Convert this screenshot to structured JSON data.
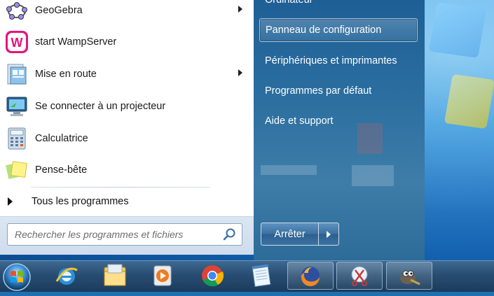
{
  "start_menu": {
    "programs": [
      {
        "label": "GeoGebra",
        "icon": "geogebra-icon",
        "has_submenu": true
      },
      {
        "label": "start WampServer",
        "icon": "wampserver-icon",
        "has_submenu": false
      },
      {
        "label": "Mise en route",
        "icon": "getting-started-icon",
        "has_submenu": true
      },
      {
        "label": "Se connecter à un projecteur",
        "icon": "projector-icon",
        "has_submenu": false
      },
      {
        "label": "Calculatrice",
        "icon": "calculator-icon",
        "has_submenu": false
      },
      {
        "label": "Pense-bête",
        "icon": "sticky-notes-icon",
        "has_submenu": false
      }
    ],
    "all_programs_label": "Tous les programmes",
    "search": {
      "placeholder": "Rechercher les programmes et fichiers"
    }
  },
  "right_pane": {
    "items": [
      {
        "label": "Ordinateur"
      },
      {
        "label": "Panneau de configuration"
      },
      {
        "label": "Périphériques et imprimantes"
      },
      {
        "label": "Programmes par défaut"
      },
      {
        "label": "Aide et support"
      }
    ],
    "shutdown_label": "Arrêter"
  },
  "taskbar": {
    "items": [
      {
        "name": "internet-explorer-icon"
      },
      {
        "name": "file-explorer-icon"
      },
      {
        "name": "media-player-icon"
      },
      {
        "name": "chrome-icon"
      },
      {
        "name": "notepad-icon"
      },
      {
        "name": "firefox-icon"
      },
      {
        "name": "snipping-tool-icon"
      },
      {
        "name": "gimp-icon"
      }
    ]
  },
  "colors": {
    "taskbar": "#284d72",
    "right_pane": "#2a6d9f",
    "accent": "#1467b8"
  }
}
